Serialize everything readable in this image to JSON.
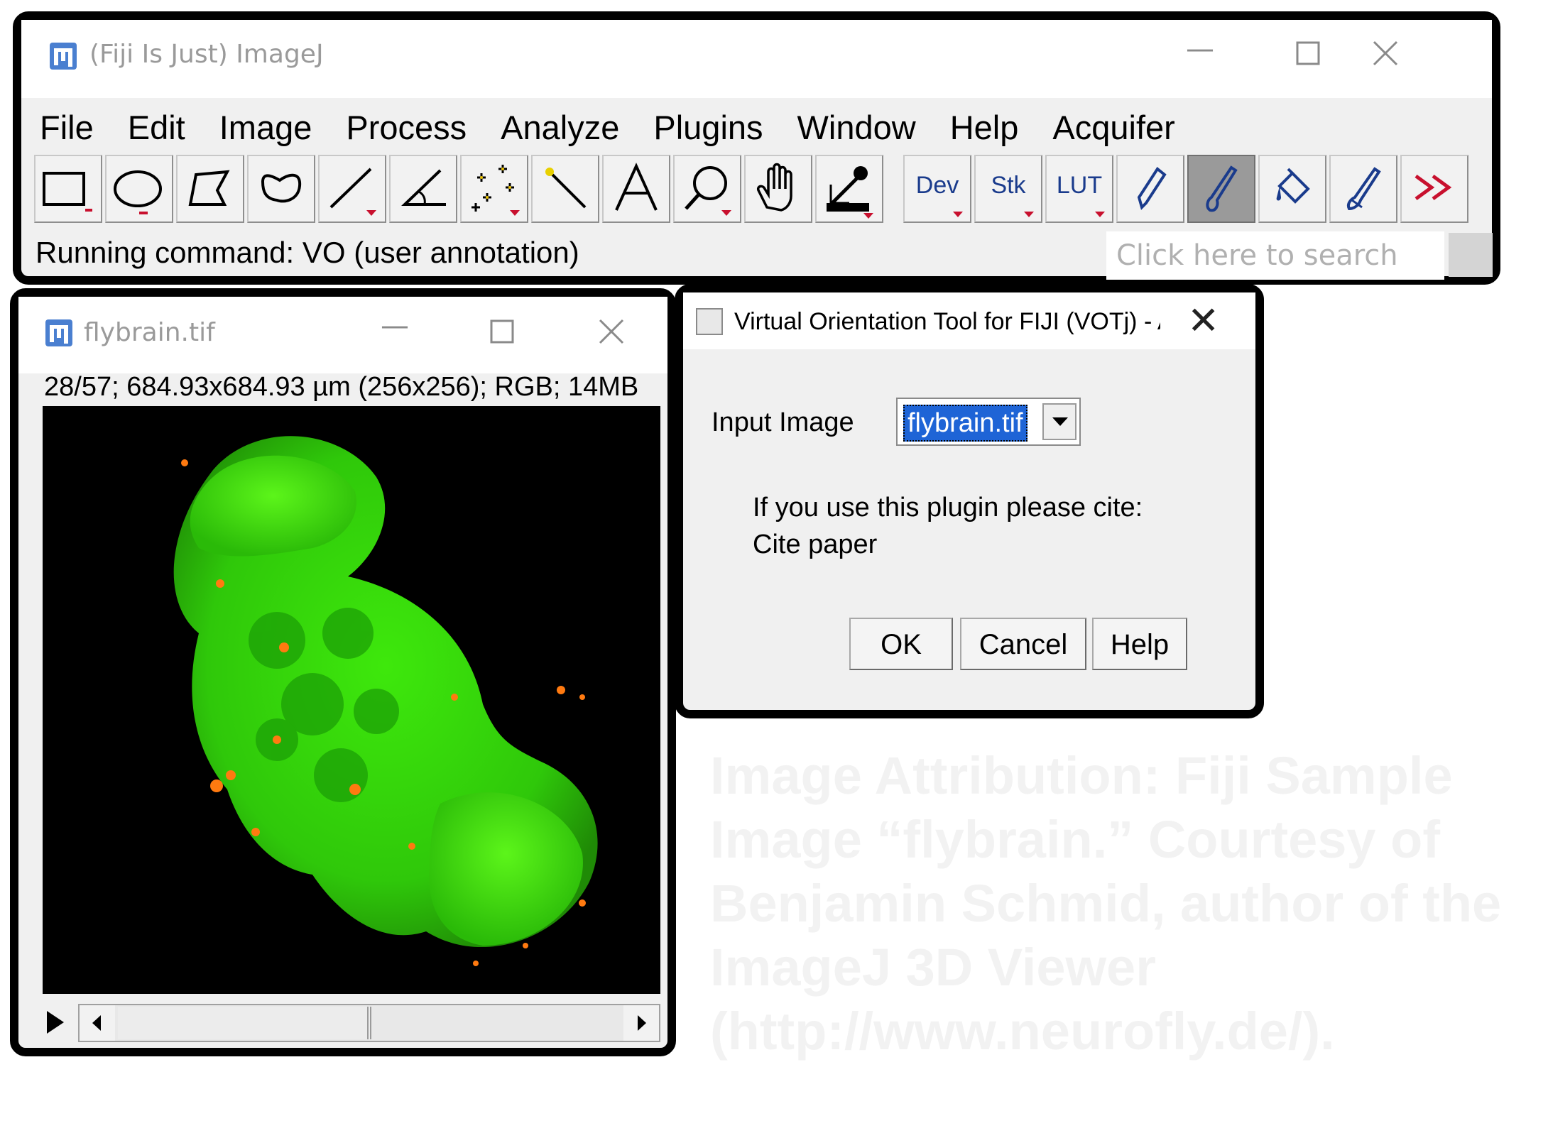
{
  "main_window": {
    "title": "(Fiji Is Just) ImageJ",
    "menu": [
      "File",
      "Edit",
      "Image",
      "Process",
      "Analyze",
      "Plugins",
      "Window",
      "Help",
      "Acquifer"
    ],
    "tools": [
      {
        "icon": "rectangle-icon"
      },
      {
        "icon": "oval-icon"
      },
      {
        "icon": "polygon-icon"
      },
      {
        "icon": "freehand-icon"
      },
      {
        "icon": "line-icon"
      },
      {
        "icon": "angle-icon"
      },
      {
        "icon": "multipoint-icon"
      },
      {
        "icon": "wand-icon"
      },
      {
        "icon": "text-icon"
      },
      {
        "icon": "magnifier-icon"
      },
      {
        "icon": "hand-icon"
      },
      {
        "icon": "color-picker-icon"
      },
      {
        "label": "Dev"
      },
      {
        "label": "Stk"
      },
      {
        "label": "LUT"
      },
      {
        "icon": "pencil-icon"
      },
      {
        "icon": "brush-icon",
        "selected": true
      },
      {
        "icon": "flood-fill-icon"
      },
      {
        "icon": "brush-alt-icon"
      },
      {
        "icon": "more-tools-icon"
      }
    ],
    "status": "Running command: VO (user annotation)",
    "search_placeholder": "Click here to search"
  },
  "image_window": {
    "title": "flybrain.tif",
    "info": "28/57; 684.93x684.93 µm (256x256); RGB; 14MB",
    "slice_fraction": 0.49
  },
  "dialog": {
    "title": "Virtual Orientation Tool for FIJI (VOTj) - Annota",
    "input_label": "Input Image",
    "input_value": "flybrain.tif",
    "cite_line1": "If you use this plugin please cite:",
    "cite_line2": "Cite paper",
    "ok": "OK",
    "cancel": "Cancel",
    "help": "Help"
  },
  "attribution": "Image Attribution: Fiji Sample Image “flybrain.” Courtesy of Benjamin Schmid, author of the ImageJ 3D Viewer (http://www.neurofly.de/).",
  "colors": {
    "accent_green": "#3ecf0a",
    "highlight_blue": "#1e64d6",
    "more_red": "#c8102e"
  }
}
